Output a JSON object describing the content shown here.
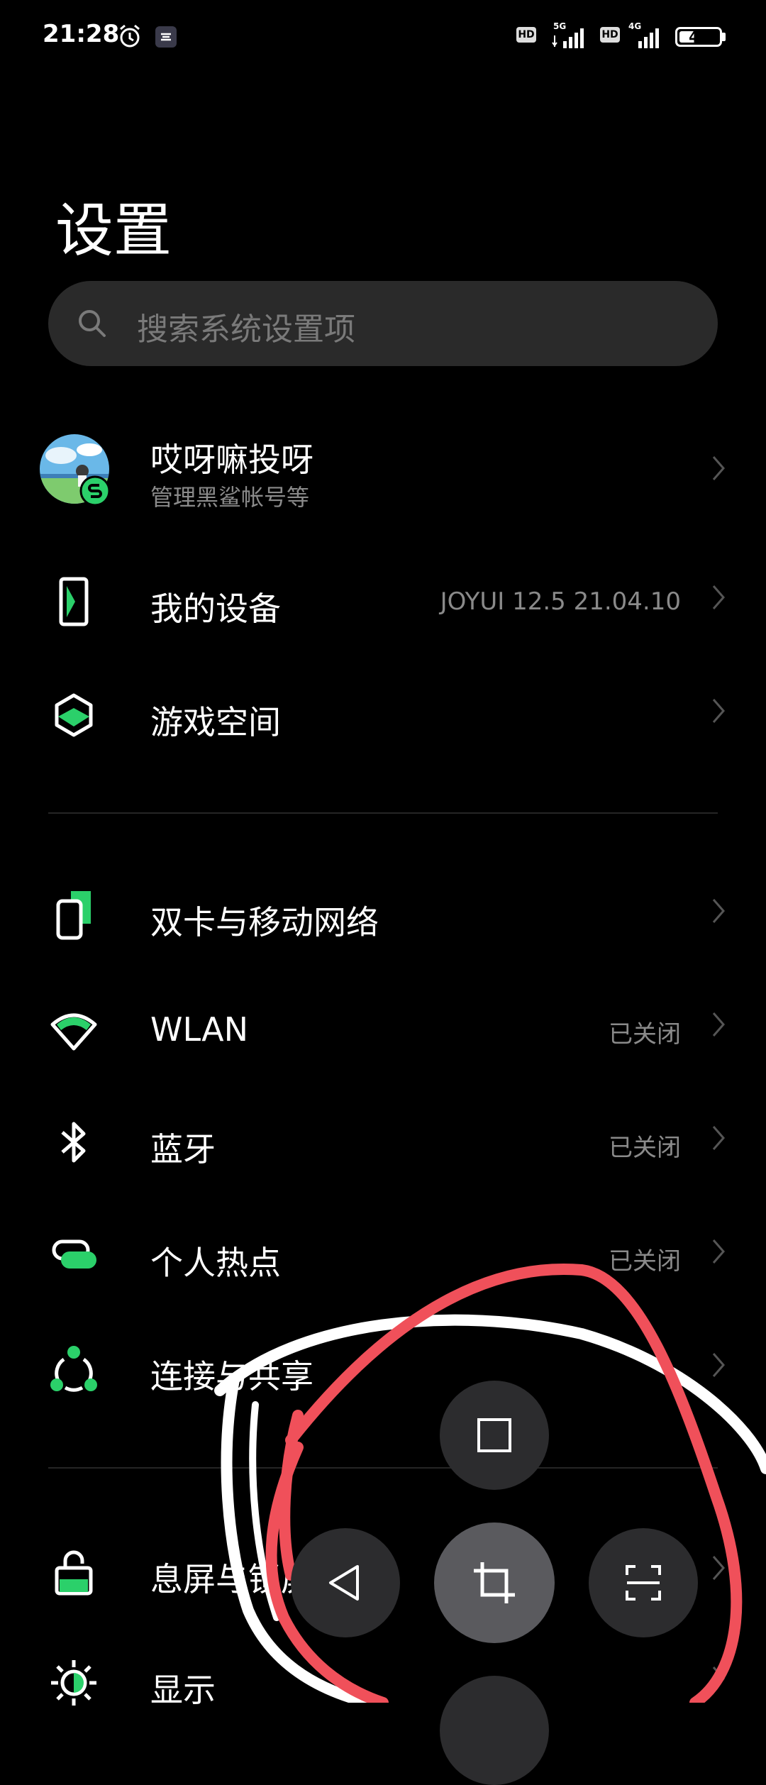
{
  "status_bar": {
    "time": "21:28",
    "net1_label": "5G",
    "net2_label": "4G",
    "hd_label": "HD",
    "battery": "40",
    "battery_level": 0.4
  },
  "header": {
    "title": "设置"
  },
  "search": {
    "placeholder": "搜索系统设置项"
  },
  "account": {
    "name": "哎呀嘛投呀",
    "subtitle": "管理黑鲨帐号等"
  },
  "settings": {
    "my_device": {
      "label": "我的设备",
      "status": "JOYUI 12.5 21.04.10"
    },
    "game_space": {
      "label": "游戏空间"
    },
    "sim": {
      "label": "双卡与移动网络"
    },
    "wlan": {
      "label": "WLAN",
      "status": "已关闭"
    },
    "bluetooth": {
      "label": "蓝牙",
      "status": "已关闭"
    },
    "hotspot": {
      "label": "个人热点",
      "status": "已关闭"
    },
    "connect_share": {
      "label": "连接与共享"
    },
    "lock_screen": {
      "label": "息屏与锁屏"
    },
    "display": {
      "label": "显示"
    }
  },
  "colors": {
    "accent": "#2bd06a",
    "background": "#000000",
    "annotation_red": "#f0505a",
    "annotation_white": "#ffffff"
  },
  "floating_menu": {
    "items": [
      "square-icon",
      "back-triangle-icon",
      "crop-icon",
      "scan-frame-icon"
    ]
  }
}
